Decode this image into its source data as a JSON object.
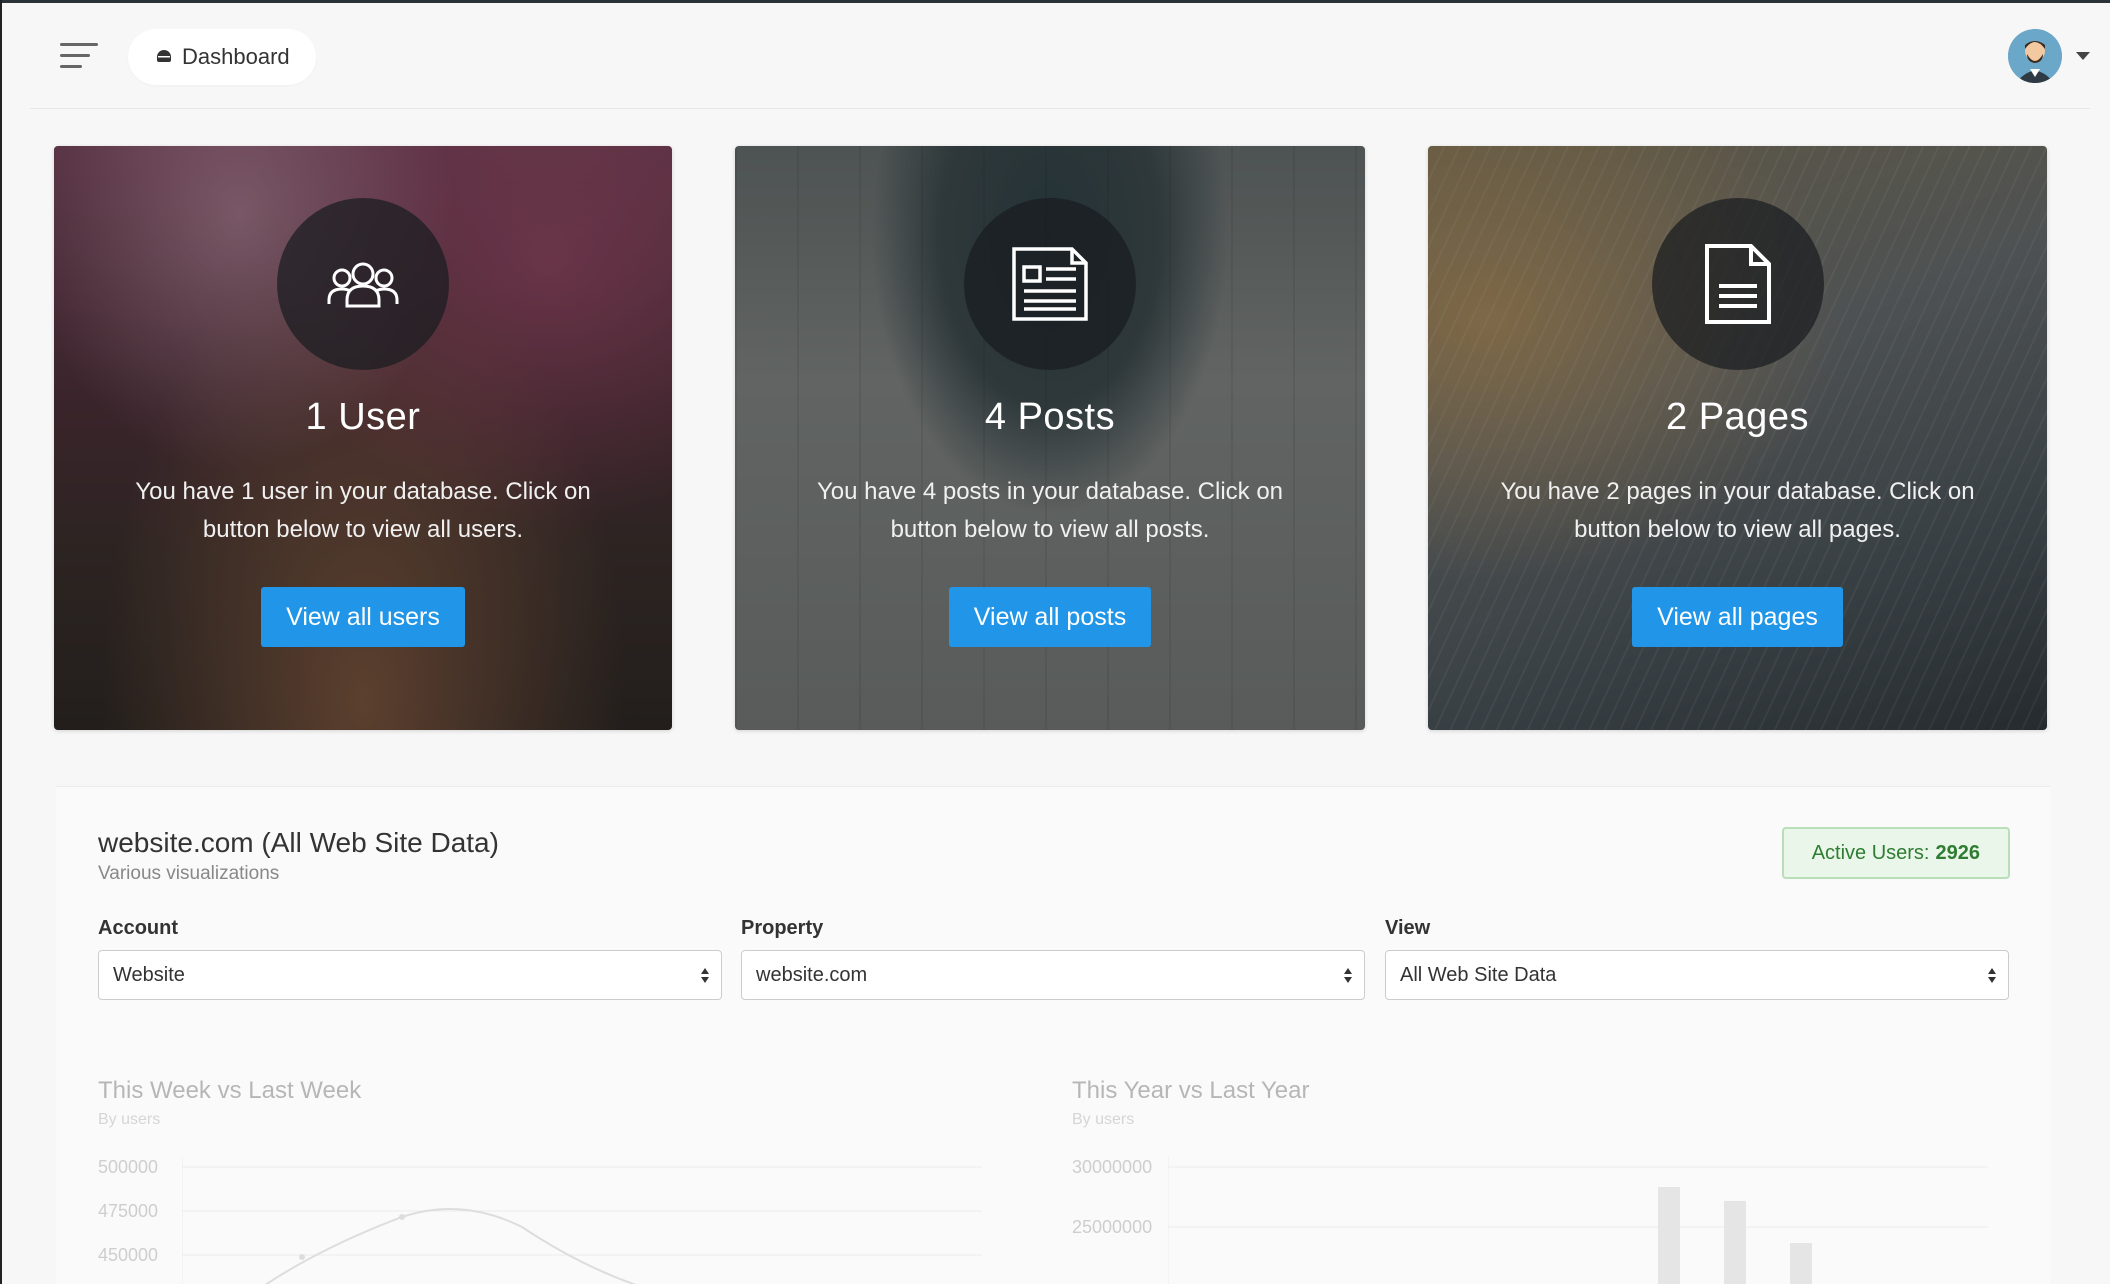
{
  "header": {
    "breadcrumb_label": "Dashboard"
  },
  "cards": [
    {
      "title": "1 User",
      "description": "You have 1 user in your database. Click on button below to view all users.",
      "button": "View all users"
    },
    {
      "title": "4 Posts",
      "description": "You have 4 posts in your database. Click on button below to view all posts.",
      "button": "View all posts"
    },
    {
      "title": "2 Pages",
      "description": "You have 2 pages in your database. Click on button below to view all pages.",
      "button": "View all pages"
    }
  ],
  "analytics": {
    "title": "website.com (All Web Site Data)",
    "subtitle": "Various visualizations",
    "active_users_label": "Active Users:",
    "active_users_value": "2926",
    "fields": {
      "account": {
        "label": "Account",
        "value": "Website"
      },
      "property": {
        "label": "Property",
        "value": "website.com"
      },
      "view": {
        "label": "View",
        "value": "All Web Site Data"
      }
    },
    "charts": {
      "week": {
        "title": "This Week vs Last Week",
        "subtitle": "By users",
        "y_ticks": [
          "500000",
          "475000",
          "450000"
        ]
      },
      "year": {
        "title": "This Year vs Last Year",
        "subtitle": "By users",
        "y_ticks": [
          "30000000",
          "25000000"
        ]
      }
    }
  },
  "colors": {
    "accent": "#2196e8",
    "success_text": "#2e7d32",
    "success_bg": "#eaf6ea"
  }
}
